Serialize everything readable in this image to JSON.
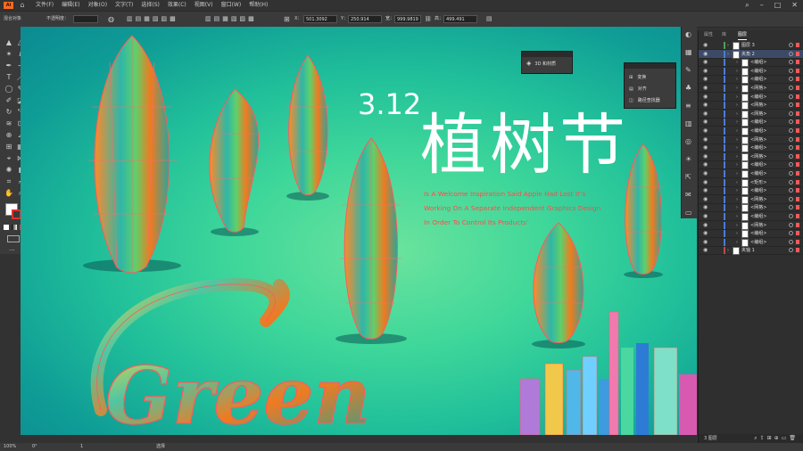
{
  "app": {
    "logo": "Ai"
  },
  "menu": {
    "items": [
      "文件(F)",
      "编辑(E)",
      "对象(O)",
      "文字(T)",
      "选择(S)",
      "效果(C)",
      "视图(V)",
      "窗口(W)",
      "帮助(H)"
    ]
  },
  "control": {
    "mode_label": "混合对象",
    "opacity_label": "不透明度：",
    "x_label": "X：",
    "x_value": "501.3092",
    "y_label": "Y：",
    "y_value": "250.914",
    "w_label": "宽：",
    "w_value": "999.9819",
    "h_label": "高：",
    "h_value": "499.491"
  },
  "panels": {
    "threed": {
      "label": "3D 和材质"
    },
    "props": {
      "items": [
        "变换",
        "对齐",
        "路径查找器"
      ]
    }
  },
  "layers": {
    "tabs": [
      "属性",
      "库",
      "图层"
    ],
    "rows": [
      {
        "name": "图层 3",
        "indent": 0,
        "bar": "#4fa05a",
        "thumb": true
      },
      {
        "name": "夹角 2",
        "indent": 0,
        "bar": "#4a7bd6",
        "thumb": true,
        "selected": true
      },
      {
        "name": "<编组>",
        "indent": 1,
        "bar": "#4a7bd6"
      },
      {
        "name": "<编组>",
        "indent": 1,
        "bar": "#4a7bd6"
      },
      {
        "name": "<编组>",
        "indent": 1,
        "bar": "#4a7bd6"
      },
      {
        "name": "<网格>",
        "indent": 1,
        "bar": "#4a7bd6"
      },
      {
        "name": "<编组>",
        "indent": 1,
        "bar": "#4a7bd6"
      },
      {
        "name": "<网格>",
        "indent": 1,
        "bar": "#4a7bd6"
      },
      {
        "name": "<网格>",
        "indent": 1,
        "bar": "#4a7bd6"
      },
      {
        "name": "<编组>",
        "indent": 1,
        "bar": "#4a7bd6"
      },
      {
        "name": "<编组>",
        "indent": 1,
        "bar": "#4a7bd6"
      },
      {
        "name": "<网格>",
        "indent": 1,
        "bar": "#4a7bd6"
      },
      {
        "name": "<编组>",
        "indent": 1,
        "bar": "#4a7bd6"
      },
      {
        "name": "<网格>",
        "indent": 1,
        "bar": "#4a7bd6"
      },
      {
        "name": "<编组>",
        "indent": 1,
        "bar": "#4a7bd6"
      },
      {
        "name": "<编组>",
        "indent": 1,
        "bar": "#4a7bd6"
      },
      {
        "name": "<矩形>",
        "indent": 1,
        "bar": "#4a7bd6"
      },
      {
        "name": "<编组>",
        "indent": 1,
        "bar": "#4a7bd6"
      },
      {
        "name": "<网格>",
        "indent": 1,
        "bar": "#4a7bd6"
      },
      {
        "name": "<网格>",
        "indent": 1,
        "bar": "#4a7bd6"
      },
      {
        "name": "<编组>",
        "indent": 1,
        "bar": "#4a7bd6"
      },
      {
        "name": "<网格>",
        "indent": 1,
        "bar": "#4a7bd6"
      },
      {
        "name": "<编组>",
        "indent": 1,
        "bar": "#4a7bd6"
      },
      {
        "name": "<编组>",
        "indent": 1,
        "bar": "#4a7bd6"
      },
      {
        "name": "夹轴 1",
        "indent": 0,
        "bar": "#c04a4a",
        "thumb": true
      }
    ],
    "footer": "3 图层"
  },
  "artwork": {
    "date": "3.12",
    "title": "植树节",
    "lines": [
      "Is A Welcome Inspiration Said Apple Had Lost It’s",
      "Working On A Separate Independent Graphics Design",
      "In Order To Control Its Products’"
    ],
    "word": "Green"
  },
  "status": {
    "zoom": "100%",
    "angle": "0°",
    "artboard": "1",
    "tool": "选择"
  }
}
